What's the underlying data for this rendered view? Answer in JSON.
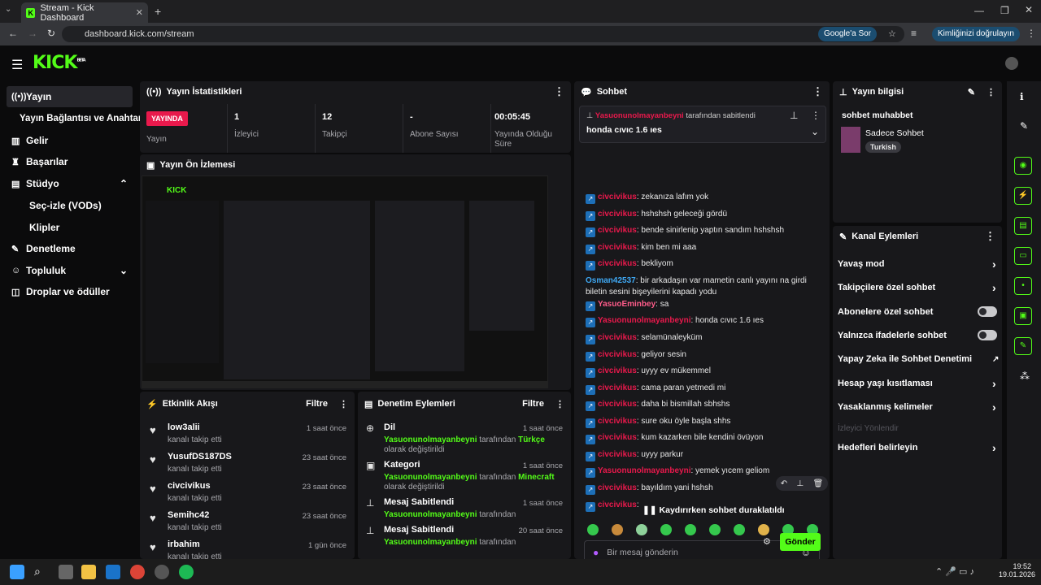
{
  "browser": {
    "tab_title": "Stream - Kick Dashboard",
    "url": "dashboard.kick.com/stream",
    "google_btn": "Google'a Sor",
    "identity_btn": "Kimliğinizi doğrulayın"
  },
  "logo": "KICK",
  "logo_badge": "BETA",
  "sidebar": {
    "items": [
      {
        "label": "Yayın",
        "icon": "broadcast-icon"
      },
      {
        "label": "Yayın Bağlantısı ve Anahtarı",
        "icon": ""
      },
      {
        "label": "Gelir",
        "icon": "chart-icon"
      },
      {
        "label": "Başarılar",
        "icon": "trophy-icon"
      },
      {
        "label": "Stüdyo",
        "icon": "film-icon"
      },
      {
        "label": "Seç-izle (VODs)",
        "icon": ""
      },
      {
        "label": "Klipler",
        "icon": ""
      },
      {
        "label": "Denetleme",
        "icon": "wrench-icon"
      },
      {
        "label": "Topluluk",
        "icon": "people-icon"
      },
      {
        "label": "Droplar ve ödüller",
        "icon": "gift-icon"
      }
    ]
  },
  "stats": {
    "title": "Yayın İstatistikleri",
    "live": "YAYINDA",
    "live_label": "Yayın",
    "items": [
      {
        "v": "1",
        "l": "İzleyici"
      },
      {
        "v": "12",
        "l": "Takipçi"
      },
      {
        "v": "-",
        "l": "Abone Sayısı"
      },
      {
        "v": "00:05:45",
        "l": "Yayında Olduğu Süre"
      }
    ]
  },
  "preview": {
    "title": "Yayın Ön İzlemesi"
  },
  "activity": {
    "title": "Etkinlik Akışı",
    "filter": "Filtre",
    "items": [
      {
        "n": "low3alii",
        "s": "kanalı takip etti",
        "t": "1 saat önce"
      },
      {
        "n": "YusufDS187DS",
        "s": "kanalı takip etti",
        "t": "23 saat önce"
      },
      {
        "n": "civcivikus",
        "s": "kanalı takip etti",
        "t": "23 saat önce"
      },
      {
        "n": "Semihc42",
        "s": "kanalı takip etti",
        "t": "23 saat önce"
      },
      {
        "n": "irbahim",
        "s": "kanalı takip etti",
        "t": "1 gün önce"
      }
    ]
  },
  "moderation": {
    "title": "Denetim Eylemleri",
    "filter": "Filtre",
    "items": [
      {
        "n": "Dil",
        "u": "Yasuonunolmayanbeyni",
        "m": "tarafından",
        "v": "Türkçe",
        "s": "olarak değiştirildi",
        "t": "1 saat önce"
      },
      {
        "n": "Kategori",
        "u": "Yasuonunolmayanbeyni",
        "m": "tarafından",
        "v": "Minecraft",
        "s": "olarak değiştirildi",
        "t": "1 saat önce"
      },
      {
        "n": "Mesaj Sabitlendi",
        "u": "Yasuonunolmayanbeyni",
        "m": "tarafından",
        "v": "",
        "s": "",
        "t": "1 saat önce"
      },
      {
        "n": "Mesaj Sabitlendi",
        "u": "Yasuonunolmayanbeyni",
        "m": "tarafından",
        "v": "",
        "s": "",
        "t": "20 saat önce"
      }
    ]
  },
  "chat": {
    "title": "Sohbet",
    "pinned_by": "Yasuonunolmayanbeyni",
    "pinned_suffix": "tarafından sabitlendi",
    "pinned_msg": "honda cıvıc 1.6 ıes",
    "messages": [
      {
        "u": "civcivikus",
        "m": ": zekanıza lafım yok",
        "c": "#e9194c"
      },
      {
        "u": "civcivikus",
        "m": ": hshshsh geleceği gördü",
        "c": "#e9194c"
      },
      {
        "u": "civcivikus",
        "m": ": bende sinirlenip yaptın sandım hshshsh",
        "c": "#e9194c"
      },
      {
        "u": "civcivikus",
        "m": ": kim ben mi aaa",
        "c": "#e9194c"
      },
      {
        "u": "civcivikus",
        "m": ": bekliyom",
        "c": "#e9194c"
      },
      {
        "u": "Osman42537",
        "m": ": bir arkadaşın var mametin canlı yayını na girdi biletin sesini bişeyilerini kapadı yodu",
        "c": "#3fa9f5"
      },
      {
        "u": "YasuoEminbey",
        "m": ": sa",
        "c": "#ff5c8a"
      },
      {
        "u": "Yasuonunolmayanbeyni",
        "m": ": honda cıvıc 1.6 ıes",
        "c": "#e9194c"
      },
      {
        "u": "civcivikus",
        "m": ": selamünaleyküm",
        "c": "#e9194c"
      },
      {
        "u": "civcivikus",
        "m": ": geliyor sesin",
        "c": "#e9194c"
      },
      {
        "u": "civcivikus",
        "m": ": uyyy ev mükemmel",
        "c": "#e9194c"
      },
      {
        "u": "civcivikus",
        "m": ": cama paran yetmedi mi",
        "c": "#e9194c"
      },
      {
        "u": "civcivikus",
        "m": ": daha bi bismillah sbhshs",
        "c": "#e9194c"
      },
      {
        "u": "civcivikus",
        "m": ": sure oku öyle başla shhs",
        "c": "#e9194c"
      },
      {
        "u": "civcivikus",
        "m": ": kum kazarken bile kendini övüyon",
        "c": "#e9194c"
      },
      {
        "u": "civcivikus",
        "m": ": uyyy parkur",
        "c": "#e9194c"
      },
      {
        "u": "Yasuonunolmayanbeyni",
        "m": ": yemek yıcem geliom",
        "c": "#e9194c"
      },
      {
        "u": "civcivikus",
        "m": ": bayıldım yani hshsh",
        "c": "#e9194c"
      },
      {
        "u": "civcivikus",
        "m": ":",
        "c": "#e9194c"
      }
    ],
    "paused": "Kaydırırken sohbet duraklatıldı",
    "placeholder": "Bir mesaj gönderin",
    "send": "Gönder"
  },
  "info": {
    "title": "Yayın bilgisi",
    "stream_title": "sohbet muhabbet",
    "category": "Sadece Sohbet",
    "tag": "Turkish"
  },
  "channel": {
    "title": "Kanal Eylemleri",
    "items": [
      {
        "l": "Yavaş mod",
        "type": "arrow"
      },
      {
        "l": "Takipçilere özel sohbet",
        "type": "arrow"
      },
      {
        "l": "Abonelere özel sohbet",
        "type": "toggle"
      },
      {
        "l": "Yalnızca ifadelerle sohbet",
        "type": "toggle"
      },
      {
        "l": "Yapay Zeka ile Sohbet Denetimi",
        "type": "ext"
      },
      {
        "l": "Hesap yaşı kısıtlaması",
        "type": "arrow"
      },
      {
        "l": "Yasaklanmış kelimeler",
        "type": "arrow"
      },
      {
        "l": "İzleyici Yönlendir",
        "type": "disabled"
      },
      {
        "l": "Hedefleri belirleyin",
        "type": "arrow"
      }
    ]
  },
  "taskbar": {
    "time": "19:52",
    "date": "19.01.2026"
  },
  "colors": {
    "accent": "#53fc18",
    "live": "#e9194c"
  }
}
